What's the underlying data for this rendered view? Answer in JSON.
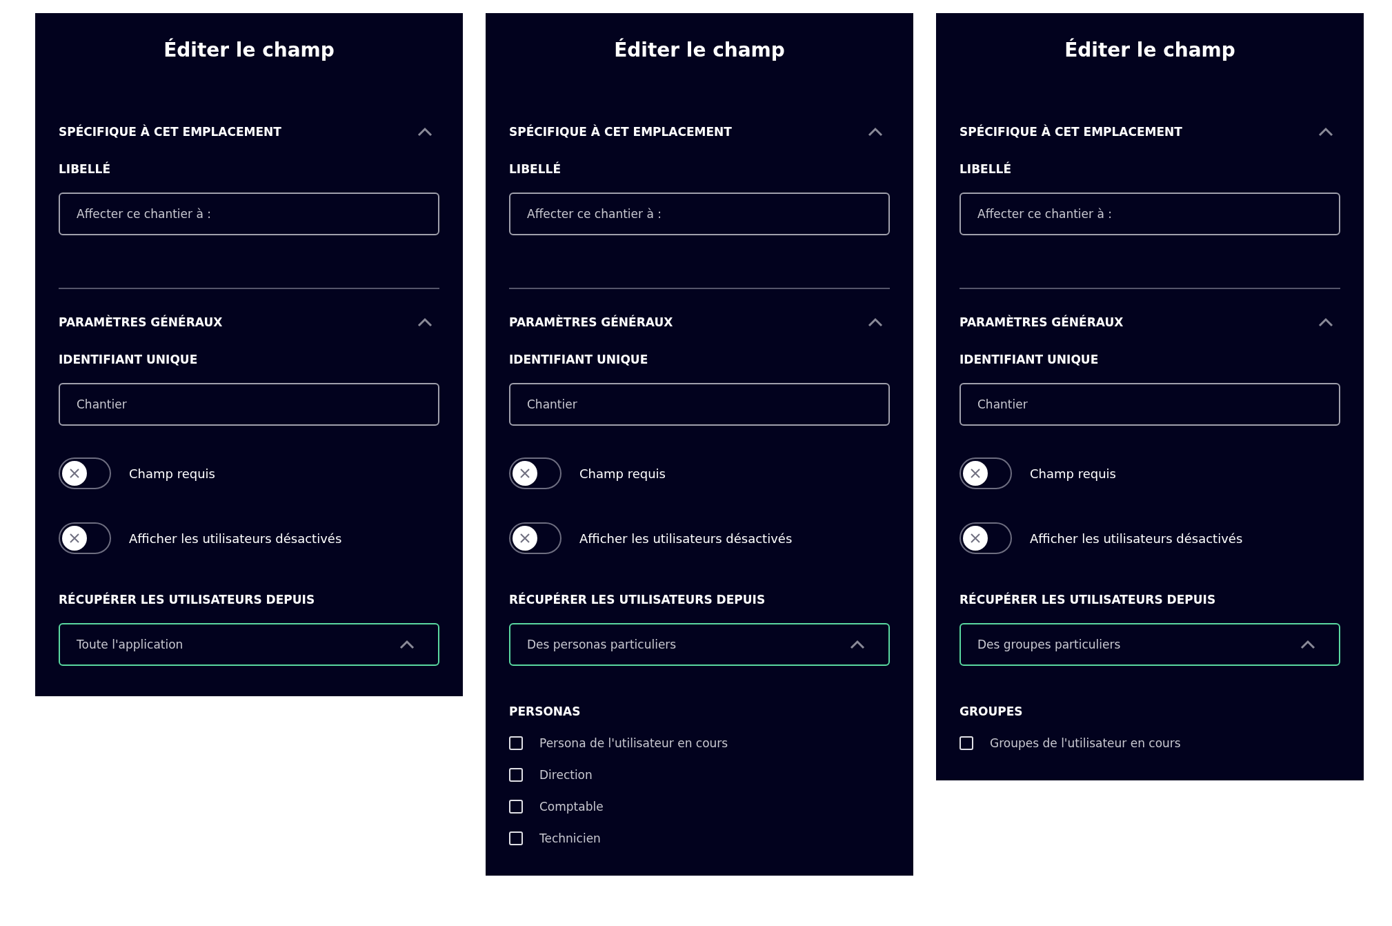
{
  "panels": [
    {
      "title": "Éditer le champ",
      "items": [
        {
          "kind": "section_header",
          "title": "SPÉCIFIQUE À CET EMPLACEMENT",
          "expanded": true
        },
        {
          "kind": "label",
          "text": "LIBELLÉ"
        },
        {
          "kind": "text_field",
          "value": "Affecter ce chantier à :"
        },
        {
          "kind": "section_header",
          "title": "PARAMÈTRES GÉNÉRAUX",
          "expanded": true
        },
        {
          "kind": "label",
          "text": "IDENTIFIANT UNIQUE"
        },
        {
          "kind": "text_field",
          "value": "Chantier"
        },
        {
          "kind": "toggle",
          "label": "Champ requis",
          "on": false
        },
        {
          "kind": "toggle",
          "label": "Afficher les utilisateurs désactivés",
          "on": false
        },
        {
          "kind": "label",
          "text": "RÉCUPÉRER LES UTILISATEURS DEPUIS"
        },
        {
          "kind": "select",
          "value": "Toute l'application",
          "expanded": true
        }
      ]
    },
    {
      "title": "Éditer le champ",
      "items": [
        {
          "kind": "section_header",
          "title": "SPÉCIFIQUE À CET EMPLACEMENT",
          "expanded": true
        },
        {
          "kind": "label",
          "text": "LIBELLÉ"
        },
        {
          "kind": "text_field",
          "value": "Affecter ce chantier à :"
        },
        {
          "kind": "section_header",
          "title": "PARAMÈTRES GÉNÉRAUX",
          "expanded": true
        },
        {
          "kind": "label",
          "text": "IDENTIFIANT UNIQUE"
        },
        {
          "kind": "text_field",
          "value": "Chantier"
        },
        {
          "kind": "toggle",
          "label": "Champ requis",
          "on": false
        },
        {
          "kind": "toggle",
          "label": "Afficher les utilisateurs désactivés",
          "on": false
        },
        {
          "kind": "label",
          "text": "RÉCUPÉRER LES UTILISATEURS DEPUIS"
        },
        {
          "kind": "select",
          "value": "Des personas particuliers",
          "expanded": true
        },
        {
          "kind": "label",
          "text": "PERSONAS"
        },
        {
          "kind": "checkbox",
          "label": "Persona de l'utilisateur en cours",
          "checked": false
        },
        {
          "kind": "checkbox",
          "label": "Direction",
          "checked": false
        },
        {
          "kind": "checkbox",
          "label": "Comptable",
          "checked": false
        },
        {
          "kind": "checkbox",
          "label": "Technicien",
          "checked": false
        }
      ]
    },
    {
      "title": "Éditer le champ",
      "items": [
        {
          "kind": "section_header",
          "title": "SPÉCIFIQUE À CET EMPLACEMENT",
          "expanded": true
        },
        {
          "kind": "label",
          "text": "LIBELLÉ"
        },
        {
          "kind": "text_field",
          "value": "Affecter ce chantier à :"
        },
        {
          "kind": "section_header",
          "title": "PARAMÈTRES GÉNÉRAUX",
          "expanded": true
        },
        {
          "kind": "label",
          "text": "IDENTIFIANT UNIQUE"
        },
        {
          "kind": "text_field",
          "value": "Chantier"
        },
        {
          "kind": "toggle",
          "label": "Champ requis",
          "on": false
        },
        {
          "kind": "toggle",
          "label": "Afficher les utilisateurs désactivés",
          "on": false
        },
        {
          "kind": "label",
          "text": "RÉCUPÉRER LES UTILISATEURS DEPUIS"
        },
        {
          "kind": "select",
          "value": "Des groupes particuliers",
          "expanded": true
        },
        {
          "kind": "label",
          "text": "GROUPES"
        },
        {
          "kind": "checkbox",
          "label": "Groupes de l'utilisateur en cours",
          "checked": false
        }
      ]
    }
  ]
}
